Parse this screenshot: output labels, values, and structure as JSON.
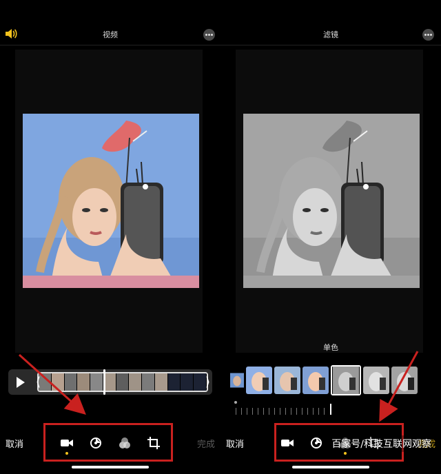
{
  "left_screen": {
    "title": "视频",
    "volume_icon": "speaker-wave-icon",
    "more_icon": "ellipsis-icon",
    "cancel_label": "取消",
    "done_label": "完成",
    "done_color": "#5a5a5a",
    "tools": [
      "video-camera-icon",
      "adjust-dial-icon",
      "filters-icon",
      "crop-rotate-icon"
    ],
    "selected_tool": 0
  },
  "right_screen": {
    "title": "滤镜",
    "more_icon": "ellipsis-icon",
    "filter_name": "单色",
    "cancel_label": "取消",
    "done_label": "完成",
    "done_color": "#f3c21d",
    "tools": [
      "video-camera-icon",
      "adjust-dial-icon",
      "filters-icon",
      "crop-rotate-icon"
    ],
    "selected_tool": 2,
    "selected_filter_index": 4
  },
  "colors": {
    "accent": "#f3c21d",
    "annotation_red": "#c9211f",
    "background": "#000000"
  },
  "watermark": "百家号/科技互联网观察"
}
